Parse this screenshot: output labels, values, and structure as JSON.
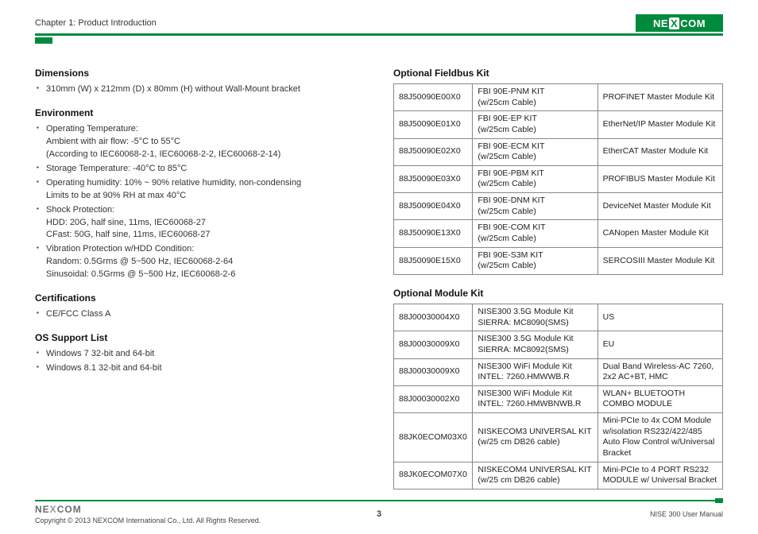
{
  "header": {
    "chapter": "Chapter 1: Product Introduction",
    "logo": "NEXCOM"
  },
  "left": {
    "dimensions": {
      "title": "Dimensions",
      "items": [
        "310mm (W) x 212mm (D) x 80mm (H) without Wall-Mount bracket"
      ]
    },
    "environment": {
      "title": "Environment",
      "items": [
        "Operating Temperature:\nAmbient with air flow: -5°C to 55°C\n(According to IEC60068-2-1, IEC60068-2-2, IEC60068-2-14)",
        "Storage Temperature: -40°C to 85°C",
        "Operating humidity: 10% ~ 90% relative humidity, non-condensing\nLimits to be at 90% RH at max 40°C",
        "Shock Protection:\nHDD: 20G, half sine, 11ms, IEC60068-27\nCFast: 50G, half sine, 11ms, IEC60068-27",
        "Vibration Protection w/HDD Condition:\nRandom: 0.5Grms @ 5~500 Hz, IEC60068-2-64\nSinusoidal: 0.5Grms @ 5~500 Hz, IEC60068-2-6"
      ]
    },
    "certifications": {
      "title": "Certifications",
      "items": [
        "CE/FCC Class A"
      ]
    },
    "os": {
      "title": "OS Support List",
      "items": [
        "Windows 7 32-bit and 64-bit",
        "Windows 8.1 32-bit and 64-bit"
      ]
    }
  },
  "right": {
    "fieldbus": {
      "title": "Optional Fieldbus Kit",
      "rows": [
        [
          "88J50090E00X0",
          "FBI 90E-PNM KIT\n(w/25cm Cable)",
          "PROFINET Master Module Kit"
        ],
        [
          "88J50090E01X0",
          "FBI 90E-EP KIT\n(w/25cm Cable)",
          "EtherNet/IP Master Module Kit"
        ],
        [
          "88J50090E02X0",
          "FBI 90E-ECM KIT\n(w/25cm Cable)",
          "EtherCAT Master Module Kit"
        ],
        [
          "88J50090E03X0",
          "FBI 90E-PBM KIT\n(w/25cm Cable)",
          "PROFIBUS Master Module Kit"
        ],
        [
          "88J50090E04X0",
          "FBI 90E-DNM KIT\n(w/25cm Cable)",
          "DeviceNet Master Module Kit"
        ],
        [
          "88J50090E13X0",
          "FBI 90E-COM KIT\n(w/25cm Cable)",
          "CANopen Master Module Kit"
        ],
        [
          "88J50090E15X0",
          "FBI 90E-S3M KIT\n(w/25cm Cable)",
          "SERCOSIII Master Module Kit"
        ]
      ]
    },
    "module": {
      "title": "Optional Module Kit",
      "rows": [
        [
          "88J00030004X0",
          "NISE300 3.5G Module Kit\nSIERRA: MC8090(SMS)",
          "US"
        ],
        [
          "88J00030009X0",
          "NISE300 3.5G Module Kit\nSIERRA: MC8092(SMS)",
          "EU"
        ],
        [
          "88J00030009X0",
          "NISE300 WiFi Module Kit\nINTEL: 7260.HMWWB.R",
          "Dual Band Wireless-AC 7260, 2x2 AC+BT, HMC"
        ],
        [
          "88J00030002X0",
          "NISE300 WiFi Module Kit\nINTEL: 7260.HMWBNWB.R",
          "WLAN+ BLUETOOTH COMBO MODULE"
        ],
        [
          "88JK0ECOM03X0",
          "NISKECOM3 UNIVERSAL KIT (w/25 cm DB26 cable)",
          "Mini-PCIe to 4x COM Module w/isolation RS232/422/485 Auto Flow Control w/Universal Bracket"
        ],
        [
          "88JK0ECOM07X0",
          "NISKECOM4 UNIVERSAL KIT (w/25 cm DB26 cable)",
          "Mini-PCIe to 4 PORT RS232 MODULE w/ Universal Bracket"
        ]
      ]
    }
  },
  "footer": {
    "logo": "NEXCOM",
    "copyright": "Copyright © 2013 NEXCOM International Co., Ltd. All Rights Reserved.",
    "page": "3",
    "manual": "NISE 300 User Manual"
  }
}
